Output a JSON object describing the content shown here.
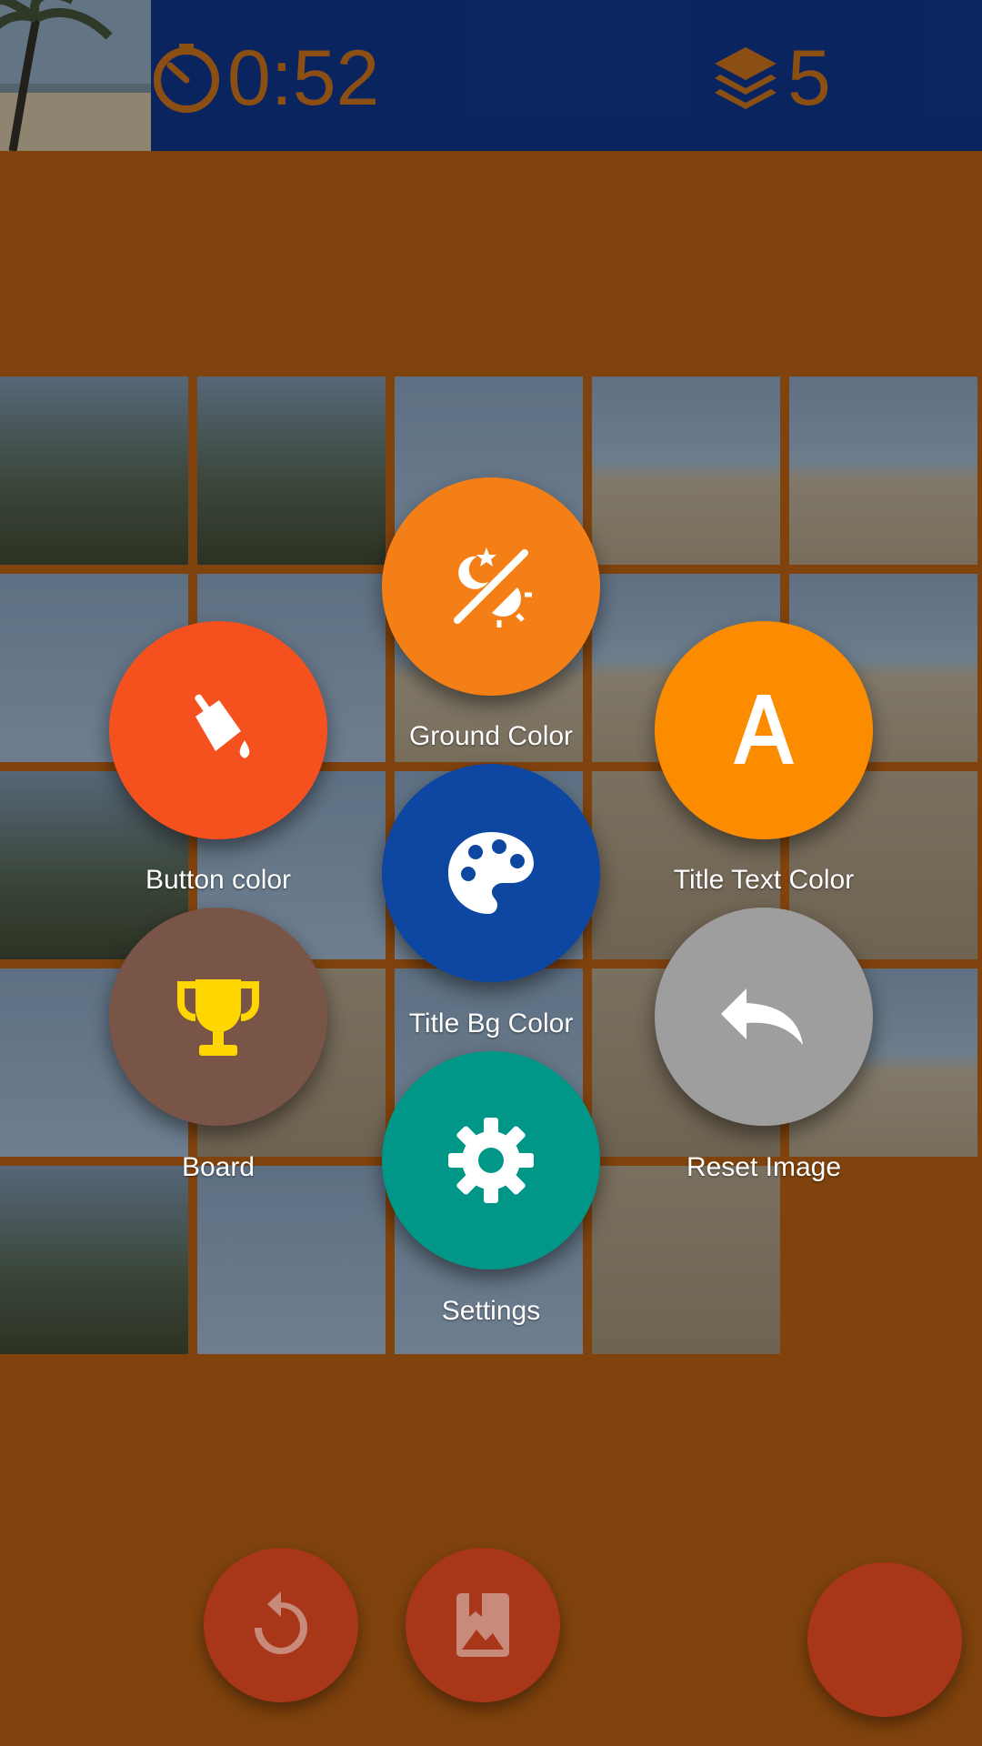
{
  "header": {
    "timer": "0:52",
    "moves": "5",
    "timer_icon": "timer-icon",
    "moves_icon": "layers-icon",
    "background": "#0d2f7b",
    "text_color": "#b2661a"
  },
  "board": {
    "background": "#a55611",
    "columns": 5,
    "rows": 5
  },
  "menu": {
    "items": [
      {
        "label": "Ground Color",
        "icon": "theme-toggle-icon",
        "color": "#f57f17"
      },
      {
        "label": "Button color",
        "icon": "paint-bucket-icon",
        "color": "#f4511e"
      },
      {
        "label": "Title Text Color",
        "icon": "letter-a-icon",
        "color": "#fb8c00"
      },
      {
        "label": "Title Bg Color",
        "icon": "palette-icon",
        "color": "#0d47a1"
      },
      {
        "label": "Board",
        "icon": "trophy-icon",
        "color": "#795548"
      },
      {
        "label": "Reset Image",
        "icon": "undo-icon",
        "color": "#9e9e9e"
      },
      {
        "label": "Settings",
        "icon": "gear-icon",
        "color": "#009688"
      }
    ]
  },
  "bottom_bar": {
    "buttons": [
      {
        "name": "restart",
        "icon": "restart-icon"
      },
      {
        "name": "image",
        "icon": "image-bookmark-icon"
      },
      {
        "name": "menu",
        "icon": ""
      }
    ],
    "color": "#a8371a"
  }
}
